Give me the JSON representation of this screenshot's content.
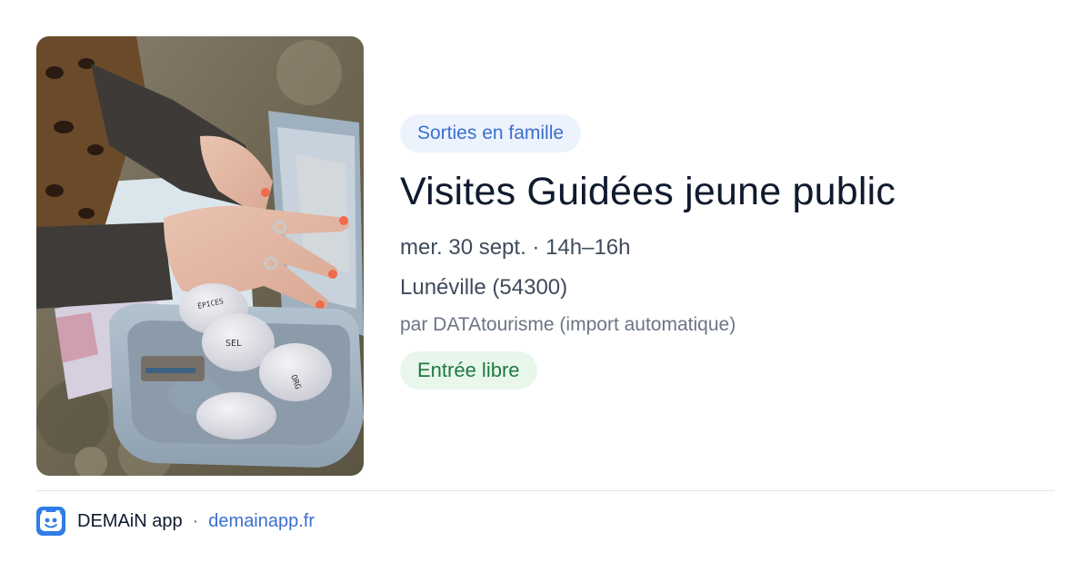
{
  "photo": {
    "icon": "event-photo-image",
    "jar_labels": [
      "SEL",
      "ORG",
      "ÉPICES"
    ]
  },
  "event": {
    "category": "Sorties en famille",
    "title": "Visites Guidées jeune public",
    "date": "mer. 30 sept. · 14h–16h",
    "location": "Lunéville (54300)",
    "organizer": "par DATAtourisme (import automatique)",
    "price": "Entrée libre"
  },
  "footer": {
    "app_name": "DEMAiN app",
    "separator": "·",
    "url": "demainapp.fr",
    "logo_icon": "demain-app-logo-icon"
  },
  "colors": {
    "category_chip_bg": "#edf3fd",
    "category_chip_text": "#3b6fcf",
    "price_chip_bg": "#e8f6ec",
    "price_chip_text": "#1f7a3e",
    "link": "#3b6fcf",
    "logo_blue": "#2f7ce6"
  }
}
